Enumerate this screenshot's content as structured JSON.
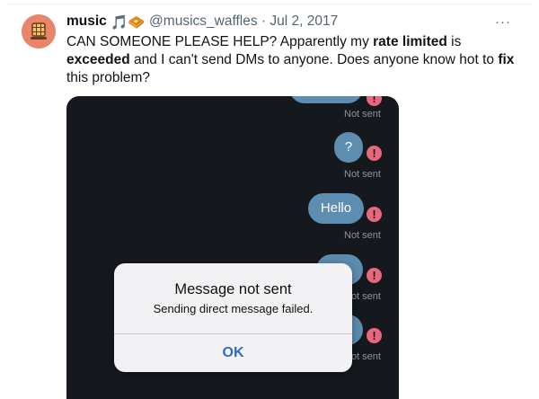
{
  "tweet": {
    "display_name": "music",
    "emoji": "🎵🧇",
    "handle": "@musics_waffles",
    "separator": "·",
    "date": "Jul 2, 2017",
    "more": "···",
    "text_parts": [
      "CAN SOMEONE PLEASE HELP? Apparently my ",
      "rate limited",
      " is ",
      "exceeded",
      " and I can't send DMs to anyone. Does anyone know hot to ",
      "fix",
      " this problem?"
    ]
  },
  "media": {
    "messages": [
      {
        "text": "",
        "status": "Not sent"
      },
      {
        "text": "?",
        "status": "Not sent"
      },
      {
        "text": "Hello",
        "status": "Not sent"
      },
      {
        "text": "",
        "status": "Not sent"
      },
      {
        "text": "",
        "status": "Not sent"
      }
    ],
    "error_glyph": "!",
    "dialog": {
      "title": "Message not sent",
      "message": "Sending direct message failed.",
      "ok_label": "OK"
    }
  },
  "colors": {
    "bubble": "#5d8db0",
    "error_badge": "#e7687c",
    "dark_background": "#15191e",
    "ok_blue": "#2d6cc0"
  }
}
